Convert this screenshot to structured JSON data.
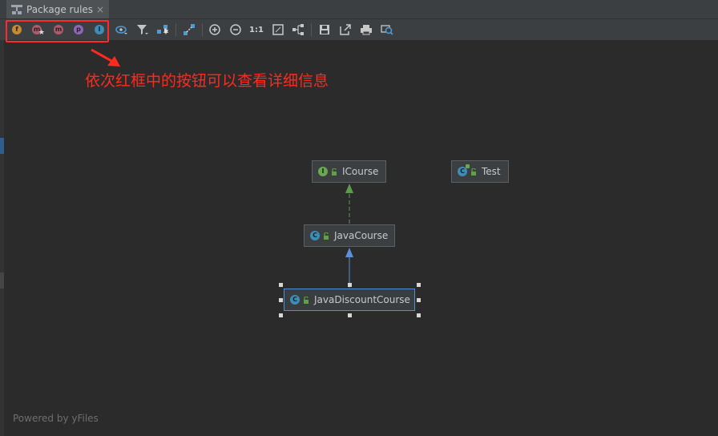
{
  "tab": {
    "title": "Package rules",
    "close": "×"
  },
  "toolbar": {
    "filters": [
      {
        "name": "fields",
        "letter": "f",
        "color": "#c88a2e"
      },
      {
        "name": "constructors",
        "letter": "m",
        "color": "#b05a6e"
      },
      {
        "name": "methods",
        "letter": "m",
        "color": "#b05a6e"
      },
      {
        "name": "properties",
        "letter": "p",
        "color": "#8e67b8"
      },
      {
        "name": "inner-classes",
        "letter": "I",
        "color": "#3b8eb8"
      }
    ],
    "zoom_actual_label": "1:1"
  },
  "annotation": {
    "text": "依次红框中的按钮可以查看详细信息",
    "color": "#ff2a1e"
  },
  "diagram": {
    "nodes": {
      "icourse": {
        "label": "ICourse",
        "kind": "I",
        "kind_color": "#6aa84f"
      },
      "test": {
        "label": "Test",
        "kind": "C",
        "kind_color": "#3b8eb8"
      },
      "javacourse": {
        "label": "JavaCourse",
        "kind": "C",
        "kind_color": "#3b8eb8"
      },
      "javadiscountcourse": {
        "label": "JavaDiscountCourse",
        "kind": "C",
        "kind_color": "#3b8eb8"
      }
    },
    "edges": [
      {
        "from": "javacourse",
        "to": "icourse",
        "type": "implements",
        "color": "#5d9a4d"
      },
      {
        "from": "javadiscountcourse",
        "to": "javacourse",
        "type": "extends",
        "color": "#5b8fd6"
      }
    ]
  },
  "footer": {
    "powered": "Powered by yFiles"
  }
}
